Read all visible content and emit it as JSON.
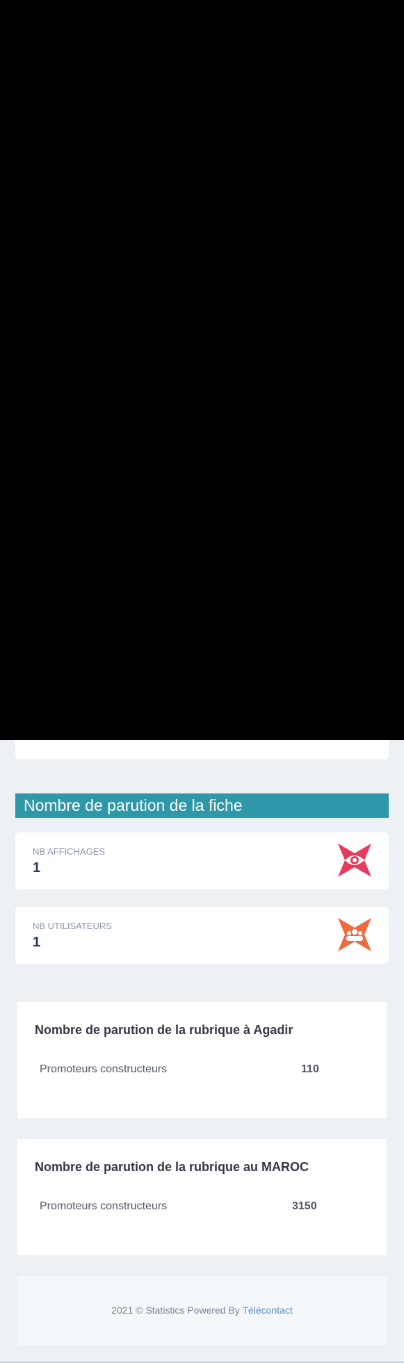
{
  "section_header": {
    "title": "Nombre de parution de la fiche"
  },
  "stats": [
    {
      "label": "NB AFFICHAGES",
      "value": "1",
      "icon": "eye-icon",
      "color": "#e83a5c"
    },
    {
      "label": "NB UTILISATEURS",
      "value": "1",
      "icon": "users-icon",
      "color": "#ef6a3c"
    }
  ],
  "rubriques": [
    {
      "title": "Nombre de parution de la rubrique à Agadir",
      "row_label": "Promoteurs constructeurs",
      "row_value": "110"
    },
    {
      "title": "Nombre de parution de la rubrique au MAROC",
      "row_label": "Promoteurs constructeurs",
      "row_value": "3150"
    }
  ],
  "footer": {
    "text": "2021 © Statistics Powered By",
    "link": "Télécontact"
  }
}
